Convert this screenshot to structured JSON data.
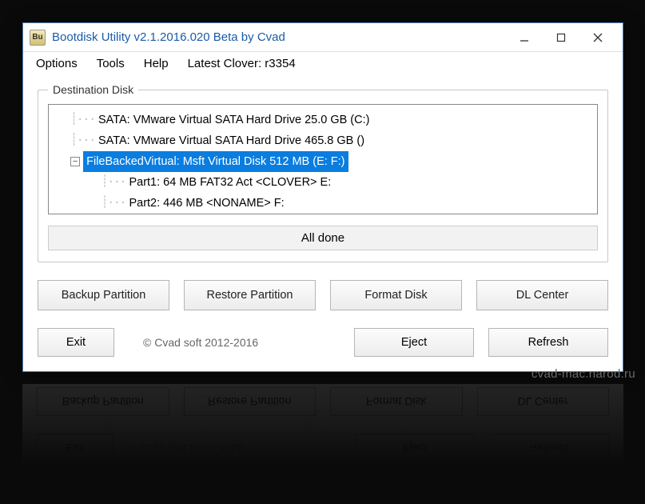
{
  "window": {
    "icon_text": "Bu",
    "title": "Bootdisk Utility v2.1.2016.020 Beta by Cvad"
  },
  "menu": {
    "options": "Options",
    "tools": "Tools",
    "help": "Help",
    "latest_clover": "Latest Clover: r3354"
  },
  "dest": {
    "legend": "Destination Disk",
    "items": [
      {
        "label": "SATA: VMware Virtual SATA Hard Drive 25.0 GB (C:)",
        "depth": 1,
        "expander": null,
        "selected": false
      },
      {
        "label": "SATA: VMware Virtual SATA Hard Drive 465.8 GB ()",
        "depth": 1,
        "expander": null,
        "selected": false
      },
      {
        "label": "FileBackedVirtual: Msft Virtual Disk 512 MB (E: F:)",
        "depth": 1,
        "expander": "−",
        "selected": true
      },
      {
        "label": "Part1: 64 MB FAT32 Act <CLOVER> E:",
        "depth": 2,
        "expander": null,
        "selected": false
      },
      {
        "label": "Part2: 446 MB <NONAME> F:",
        "depth": 2,
        "expander": null,
        "selected": false
      }
    ]
  },
  "status": "All done",
  "buttons": {
    "backup": "Backup Partition",
    "restore": "Restore Partition",
    "format": "Format Disk",
    "dlcenter": "DL Center",
    "exit": "Exit",
    "eject": "Eject",
    "refresh": "Refresh"
  },
  "copyright": "© Cvad soft 2012-2016",
  "watermark": "cvad-mac.narod.ru"
}
